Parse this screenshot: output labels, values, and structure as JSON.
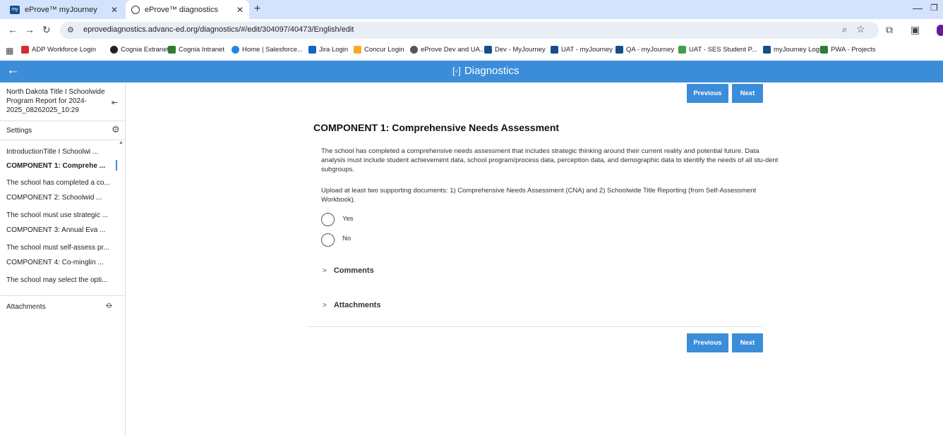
{
  "browser": {
    "tabs": [
      {
        "label": "eProve™ myJourney",
        "icon": "myjourney-icon",
        "active": false
      },
      {
        "label": "eProve™ diagnostics",
        "icon": "globe-icon",
        "active": true
      }
    ],
    "url": "eprovediagnostics.advanc-ed.org/diagnostics/#/edit/304097/40473/English/edit",
    "bookmarks": [
      {
        "label": "ADP Workforce Login",
        "color": "#d32f2f"
      },
      {
        "label": "Cognia Extranet",
        "color": "#222222"
      },
      {
        "label": "Cognia Intranet",
        "color": "#2e7d32"
      },
      {
        "label": "Home | Salesforce...",
        "color": "#1e88e5"
      },
      {
        "label": "Jira Login",
        "color": "#1565c0"
      },
      {
        "label": "Concur Login",
        "color": "#f9a825"
      },
      {
        "label": "eProve Dev and UA...",
        "color": "#555555"
      },
      {
        "label": "Dev - MyJourney",
        "color": "#1a4c8a"
      },
      {
        "label": "UAT - myJourney",
        "color": "#1a4c8a"
      },
      {
        "label": "QA - myJourney",
        "color": "#1a4c8a"
      },
      {
        "label": "UAT - SES Student P...",
        "color": "#43a047"
      },
      {
        "label": "myJourney Login",
        "color": "#1a4c8a"
      },
      {
        "label": "PWA - Projects",
        "color": "#2e7d32"
      }
    ]
  },
  "app": {
    "title": "Diagnostics",
    "accent": "#3c8dd9"
  },
  "sidebar": {
    "report_title": "North Dakota Title I Schoolwide Program Report for 2024-2025_08262025_10:29",
    "settings_label": "Settings",
    "items": [
      {
        "label": "IntroductionTitle I Schoolwi ...",
        "active": false
      },
      {
        "label": "COMPONENT 1: Comprehe ...",
        "active": true
      },
      {
        "label": "The school has completed a co...",
        "active": false
      },
      {
        "label": "COMPONENT 2: Schoolwid ...",
        "active": false
      },
      {
        "label": "The school must use strategic ...",
        "active": false
      },
      {
        "label": "COMPONENT 3: Annual Eva ...",
        "active": false
      },
      {
        "label": "The school must self-assess pr...",
        "active": false
      },
      {
        "label": "COMPONENT 4: Co-minglin ...",
        "active": false
      },
      {
        "label": "The school may select the opti...",
        "active": false
      }
    ],
    "attachments_label": "Attachments"
  },
  "main": {
    "previous_label": "Previous",
    "next_label": "Next",
    "component_title": "COMPONENT 1: Comprehensive Needs Assessment",
    "description": "The school has completed a comprehensive needs assessment that includes strategic thinking around their current reality and potential future. Data analysis must include student achievement data, school program/process data, perception data, and demographic data to identify the needs of all stu-dent subgroups.",
    "upload_instructions": "Upload at least two supporting documents: 1) Comprehensive Needs Assessment (CNA) and 2) Schoolwide Title Reporting (from Self-Assessment Workbook).",
    "options": [
      "Yes",
      "No"
    ],
    "comments_label": "Comments",
    "attachments_label": "Attachments"
  }
}
